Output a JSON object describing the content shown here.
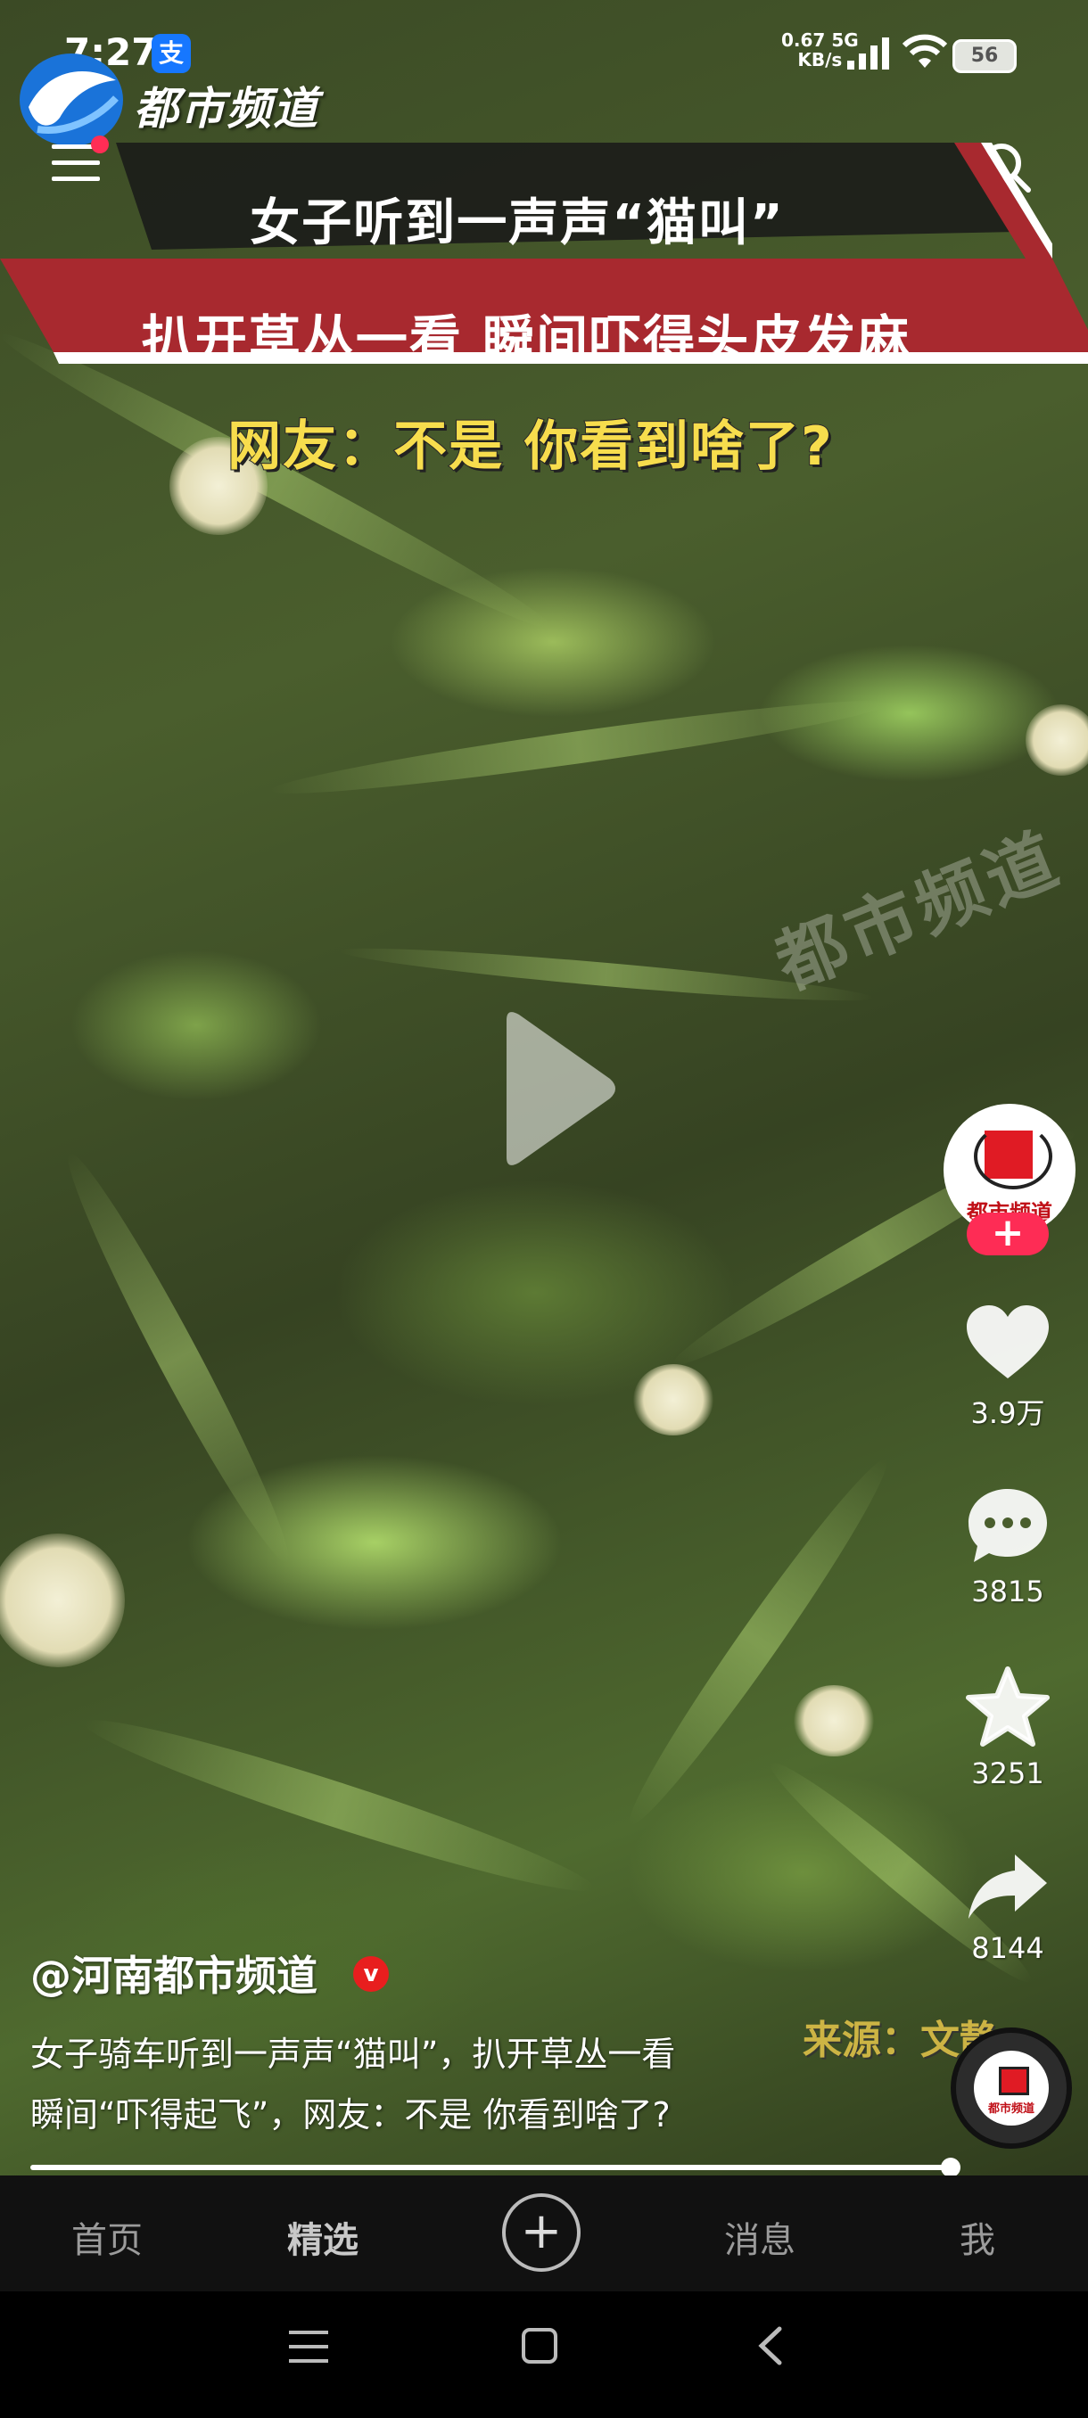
{
  "status_bar": {
    "time": "7:27",
    "app_badge": "支",
    "net_speed_value": "0.67",
    "net_speed_unit": "KB/s",
    "network": "5G",
    "battery": "56"
  },
  "channel": {
    "logo_text": "都市频道"
  },
  "video": {
    "title_line1": "女子听到一声声“猫叫”",
    "title_line2": "扒开草丛一看 瞬间吓得头皮发麻",
    "subtitle": "网友：不是 你看到啥了?",
    "watermark": "都市频道",
    "source_label": "来源：文静"
  },
  "sidebar": {
    "avatar_text": "都市频道",
    "follow_label": "+",
    "likes": "3.9万",
    "comments": "3815",
    "favorites": "3251",
    "shares": "8144"
  },
  "info": {
    "author": "@河南都市频道",
    "verified_badge": "v",
    "description_line1": "女子骑车听到一声声“猫叫”，扒开草丛一看",
    "description_line2": "瞬间“吓得起飞”，网友：不是 你看到啥了?"
  },
  "music_disc_text": "都市频道",
  "playback": {
    "progress": 0.97
  },
  "tabbar": {
    "home": "首页",
    "featured": "精选",
    "create": "+",
    "messages": "消息",
    "me": "我"
  },
  "icons": {
    "menu": "menu-icon",
    "search": "search-icon",
    "play": "play-icon",
    "like": "heart-icon",
    "comment": "comment-icon",
    "favorite": "star-icon",
    "share": "share-icon"
  },
  "colors": {
    "title_band": "#a8292f",
    "subtitle_text": "#f7dd4d",
    "follow": "#fe2c55",
    "verified": "#e81e1e"
  }
}
